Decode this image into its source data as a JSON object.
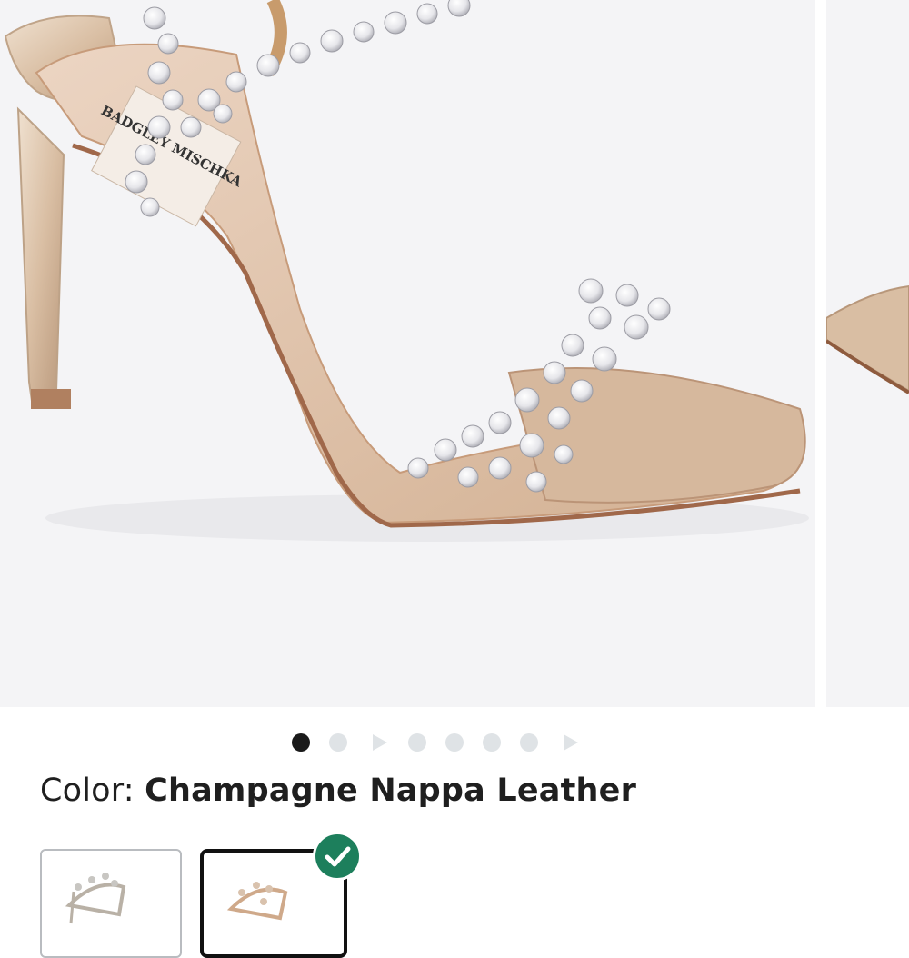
{
  "gallery": {
    "main_image": "Rhinestone strappy high-heel sandal in champagne metallic leather",
    "next_image": "Partial view of next product photo",
    "slide_indicators": [
      {
        "type": "image",
        "active": true
      },
      {
        "type": "image",
        "active": false
      },
      {
        "type": "video",
        "active": false
      },
      {
        "type": "image",
        "active": false
      },
      {
        "type": "image",
        "active": false
      },
      {
        "type": "image",
        "active": false
      },
      {
        "type": "image",
        "active": false
      },
      {
        "type": "video",
        "active": false
      }
    ],
    "insole_label_text": "BADGLEY MISCHKA"
  },
  "color": {
    "label": "Color:",
    "value": "Champagne Nappa Leather"
  },
  "swatches": [
    {
      "name": "Silver variant",
      "selected": false
    },
    {
      "name": "Champagne Nappa Leather",
      "selected": true
    }
  ],
  "icons": {
    "selected": "check-icon",
    "video": "play-icon"
  },
  "colors": {
    "gallery_bg": "#f4f4f6",
    "active_dot": "#1a1a1a",
    "inactive_dot": "#dfe3e6",
    "check_badge": "#1d7f5c",
    "selected_border": "#111111"
  }
}
